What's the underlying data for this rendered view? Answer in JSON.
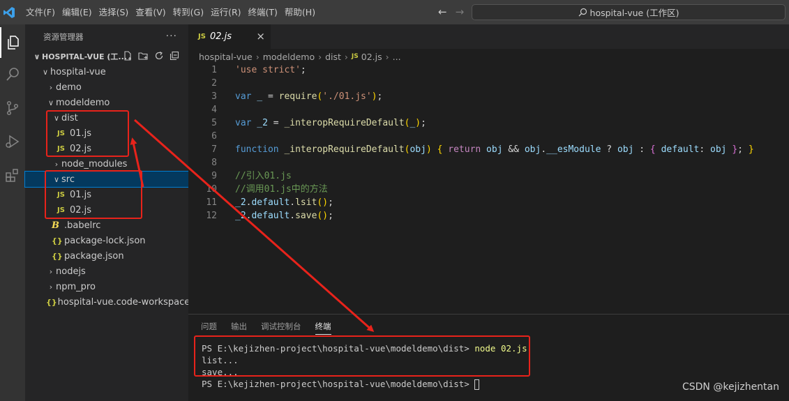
{
  "titlebar": {
    "menu": [
      "文件(F)",
      "编辑(E)",
      "选择(S)",
      "查看(V)",
      "转到(G)",
      "运行(R)",
      "终端(T)",
      "帮助(H)"
    ],
    "search": "hospital-vue (工作区)",
    "nav_back": "←",
    "nav_forward": "→"
  },
  "sidebar": {
    "title": "资源管理器",
    "more": "···",
    "workspace": "HOSPITAL-VUE (工...",
    "tree": [
      {
        "label": "hospital-vue",
        "chev": "∨",
        "icon": ""
      },
      {
        "label": "demo",
        "chev": "›",
        "icon": ""
      },
      {
        "label": "modeldemo",
        "chev": "∨",
        "icon": ""
      },
      {
        "label": "dist",
        "chev": "∨",
        "icon": ""
      },
      {
        "label": "01.js",
        "chev": "",
        "icon": "JS"
      },
      {
        "label": "02.js",
        "chev": "",
        "icon": "JS"
      },
      {
        "label": "node_modules",
        "chev": "›",
        "icon": ""
      },
      {
        "label": "src",
        "chev": "∨",
        "icon": ""
      },
      {
        "label": "01.js",
        "chev": "",
        "icon": "JS"
      },
      {
        "label": "02.js",
        "chev": "",
        "icon": "JS"
      },
      {
        "label": ".babelrc",
        "chev": "",
        "icon": "B"
      },
      {
        "label": "package-lock.json",
        "chev": "",
        "icon": "{}"
      },
      {
        "label": "package.json",
        "chev": "",
        "icon": "{}"
      },
      {
        "label": "nodejs",
        "chev": "›",
        "icon": ""
      },
      {
        "label": "npm_pro",
        "chev": "›",
        "icon": ""
      },
      {
        "label": "hospital-vue.code-workspace",
        "chev": "",
        "icon": "{}"
      }
    ]
  },
  "editor": {
    "tab": {
      "icon": "JS",
      "name": "02.js",
      "close": "×"
    },
    "breadcrumb": [
      "hospital-vue",
      "modeldemo",
      "dist",
      "02.js",
      "..."
    ],
    "breadcrumb_icon": "JS",
    "line_numbers": [
      "1",
      "2",
      "3",
      "4",
      "5",
      "6",
      "7",
      "8",
      "9",
      "10",
      "11",
      "12"
    ],
    "code": {
      "l1_str": "'use strict'",
      "l1_end": ";",
      "l3_kw": "var",
      "l3_var": " _ ",
      "l3_eq": "= ",
      "l3_fn": "require",
      "l3_open": "(",
      "l3_str": "'./01.js'",
      "l3_close": ")",
      "l3_end": ";",
      "l5_kw": "var",
      "l5_var": " _2 ",
      "l5_eq": "= ",
      "l5_fn": "_interopRequireDefault",
      "l5_open": "(",
      "l5_arg": "_",
      "l5_close": ")",
      "l5_end": ";",
      "l7_kw": "function",
      "l7_fn": " _interopRequireDefault",
      "l7_open": "(",
      "l7_arg": "obj",
      "l7_close": ")",
      "l7_brace1": " { ",
      "l7_ret": "return",
      "l7_obj1": " obj ",
      "l7_and": "&& ",
      "l7_obj2": "obj",
      "l7_dot": ".",
      "l7_prop": "__esModule",
      "l7_q": " ? ",
      "l7_obj3": "obj",
      "l7_colon": " : ",
      "l7_ob": "{ ",
      "l7_key": "default",
      "l7_kc": ": ",
      "l7_obj4": "obj",
      "l7_cb": " }",
      "l7_semi": "; ",
      "l7_brace2": "}",
      "l9": "//引入01.js",
      "l10": "//调用01.js中的方法",
      "l11_v": "_2",
      "l11_d": ".",
      "l11_def": "default",
      "l11_d2": ".",
      "l11_fn": "lsit",
      "l11_par": "()",
      "l11_end": ";",
      "l12_v": "_2",
      "l12_d": ".",
      "l12_def": "default",
      "l12_d2": ".",
      "l12_fn": "save",
      "l12_par": "()",
      "l12_end": ";"
    }
  },
  "panel": {
    "tabs": [
      "问题",
      "输出",
      "调试控制台",
      "终端"
    ],
    "active_tab": "终端",
    "terminal": {
      "prompt1": "PS E:\\kejizhen-project\\hospital-vue\\modeldemo\\dist> ",
      "cmd1": "node 02.js",
      "out1": "list...",
      "out2": "save...",
      "prompt2": "PS E:\\kejizhen-project\\hospital-vue\\modeldemo\\dist> "
    }
  },
  "watermark": "CSDN @kejizhentan",
  "colors": {
    "annotation": "#e8231b",
    "accent": "#007fd4"
  }
}
